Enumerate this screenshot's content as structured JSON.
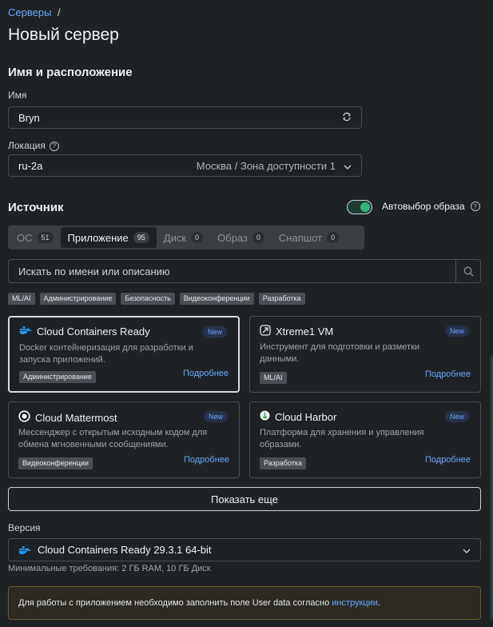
{
  "breadcrumb": {
    "link": "Серверы",
    "separator": "/"
  },
  "page_title": "Новый сервер",
  "name_location": {
    "heading": "Имя и расположение",
    "name_label": "Имя",
    "name_value": "Bryn",
    "location_label": "Локация",
    "location_value": "ru-2a",
    "location_detail": "Москва / Зона доступности 1"
  },
  "source": {
    "heading": "Источник",
    "auto_select_label": "Автовыбор образа",
    "auto_select_on": true,
    "tabs": [
      {
        "label": "ОС",
        "count": "51",
        "active": false
      },
      {
        "label": "Приложение",
        "count": "95",
        "active": true
      },
      {
        "label": "Диск",
        "count": "0",
        "active": false
      },
      {
        "label": "Образ",
        "count": "0",
        "active": false
      },
      {
        "label": "Снапшот",
        "count": "0",
        "active": false
      }
    ],
    "search_placeholder": "Искать по имени или описанию",
    "chips": [
      "ML/AI",
      "Администрирование",
      "Безопасность",
      "Видеоконференции",
      "Разработка"
    ],
    "cards": [
      {
        "title": "Cloud Containers Ready",
        "badge": "New",
        "desc": "Docker контейнеризация для разработки и запуска приложений.",
        "tag": "Администрирование",
        "more": "Подробнее",
        "icon": "docker-icon",
        "selected": true
      },
      {
        "title": "Xtreme1 VM",
        "badge": "New",
        "desc": "Инструмент для подготовки и разметки данными.",
        "tag": "ML/AI",
        "more": "Подробнее",
        "icon": "xtreme-icon",
        "selected": false
      },
      {
        "title": "Cloud Mattermost",
        "badge": "New",
        "desc": "Мессенджер с открытым исходным кодом для обмена мгновенными сообщениями.",
        "tag": "Видеоконференции",
        "more": "Подробнее",
        "icon": "mattermost-icon",
        "selected": false
      },
      {
        "title": "Cloud Harbor",
        "badge": "New",
        "desc": "Платформа для хранения и управления образами.",
        "tag": "Разработка",
        "more": "Подробнее",
        "icon": "harbor-icon",
        "selected": false
      }
    ],
    "show_more": "Показать еще"
  },
  "version": {
    "label": "Версия",
    "value": "Cloud Containers Ready 29.3.1 64-bit",
    "requirements": "Минимальные требования: 2 ГБ RAM, 10 ГБ Диск"
  },
  "notice": {
    "text": "Для работы с приложением необходимо заполнить поле User data согласно ",
    "link": "инструкции",
    "suffix": "."
  }
}
